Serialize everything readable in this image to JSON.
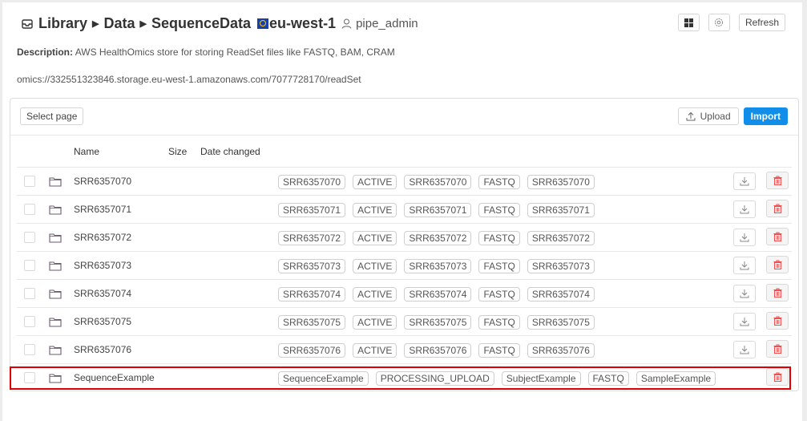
{
  "header": {
    "breadcrumbs": [
      "Library",
      "Data",
      "SequenceData"
    ],
    "region": "eu-west-1",
    "owner": "pipe_admin",
    "buttons": {
      "grid_icon": "grid-icon",
      "settings_icon": "gear-icon",
      "refresh_label": "Refresh"
    }
  },
  "description": {
    "label": "Description:",
    "text": "AWS HealthOmics store for storing ReadSet files like FASTQ, BAM, CRAM"
  },
  "storage_path": "omics://332551323846.storage.eu-west-1.amazonaws.com/7077728170/readSet",
  "toolbar": {
    "select_page_label": "Select page",
    "upload_label": "Upload",
    "import_label": "Import"
  },
  "table": {
    "columns": {
      "name": "Name",
      "size": "Size",
      "date_changed": "Date changed"
    },
    "rows": [
      {
        "name": "SRR6357070",
        "tags": [
          "SRR6357070",
          "ACTIVE",
          "SRR6357070",
          "FASTQ",
          "SRR6357070"
        ],
        "downloadable": true
      },
      {
        "name": "SRR6357071",
        "tags": [
          "SRR6357071",
          "ACTIVE",
          "SRR6357071",
          "FASTQ",
          "SRR6357071"
        ],
        "downloadable": true
      },
      {
        "name": "SRR6357072",
        "tags": [
          "SRR6357072",
          "ACTIVE",
          "SRR6357072",
          "FASTQ",
          "SRR6357072"
        ],
        "downloadable": true
      },
      {
        "name": "SRR6357073",
        "tags": [
          "SRR6357073",
          "ACTIVE",
          "SRR6357073",
          "FASTQ",
          "SRR6357073"
        ],
        "downloadable": true
      },
      {
        "name": "SRR6357074",
        "tags": [
          "SRR6357074",
          "ACTIVE",
          "SRR6357074",
          "FASTQ",
          "SRR6357074"
        ],
        "downloadable": true
      },
      {
        "name": "SRR6357075",
        "tags": [
          "SRR6357075",
          "ACTIVE",
          "SRR6357075",
          "FASTQ",
          "SRR6357075"
        ],
        "downloadable": true
      },
      {
        "name": "SRR6357076",
        "tags": [
          "SRR6357076",
          "ACTIVE",
          "SRR6357076",
          "FASTQ",
          "SRR6357076"
        ],
        "downloadable": true
      },
      {
        "name": "SequenceExample",
        "tags": [
          "SequenceExample",
          "PROCESSING_UPLOAD",
          "SubjectExample",
          "FASTQ",
          "SampleExample"
        ],
        "downloadable": false,
        "highlighted": true
      }
    ]
  },
  "colors": {
    "accent": "#108ee9",
    "delete": "#f05050",
    "highlight": "#e00000"
  }
}
